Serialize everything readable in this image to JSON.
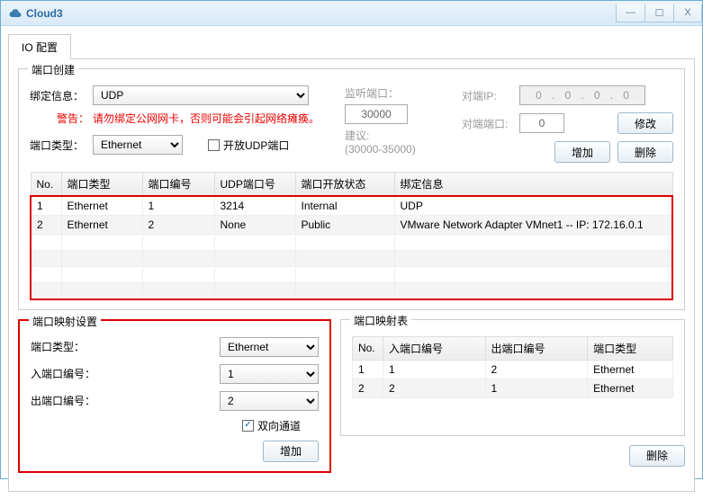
{
  "window": {
    "title": "Cloud3"
  },
  "tab": {
    "label": "IO 配置"
  },
  "portCreate": {
    "legend": "端口创建",
    "bindInfoLabel": "绑定信息：",
    "bindInfoValue": "UDP",
    "warningLabel": "警告：",
    "warningText": "请勿绑定公网网卡，否则可能会引起网络瘫痪。",
    "portTypeLabel": "端口类型：",
    "portTypeValue": "Ethernet",
    "openUdpLabel": "开放UDP端口",
    "listenPortLabel": "监听端口：",
    "listenPortValue": "30000",
    "suggestLabel": "建议:",
    "suggestRange": "(30000-35000)",
    "peerIpLabel": "对端IP:",
    "peerIp": {
      "a": "0",
      "b": "0",
      "c": "0",
      "d": "0"
    },
    "peerPortLabel": "对端端口:",
    "peerPortValue": "0",
    "modifyBtn": "修改",
    "addBtn": "增加",
    "deleteBtn": "删除",
    "table": {
      "headers": {
        "no": "No.",
        "type": "端口类型",
        "num": "端口编号",
        "udp": "UDP端口号",
        "open": "端口开放状态",
        "bind": "绑定信息"
      },
      "rows": [
        {
          "no": "1",
          "type": "Ethernet",
          "num": "1",
          "udp": "3214",
          "open": "Internal",
          "bind": "UDP"
        },
        {
          "no": "2",
          "type": "Ethernet",
          "num": "2",
          "udp": "None",
          "open": "Public",
          "bind": "VMware Network Adapter VMnet1 -- IP: 172.16.0.1"
        }
      ]
    }
  },
  "mapSettings": {
    "legend": "端口映射设置",
    "portTypeLabel": "端口类型：",
    "portTypeValue": "Ethernet",
    "inLabel": "入端口编号：",
    "inValue": "1",
    "outLabel": "出端口编号：",
    "outValue": "2",
    "bidiLabel": "双向通道",
    "addBtn": "增加"
  },
  "mapTable": {
    "legend": "端口映射表",
    "headers": {
      "no": "No.",
      "in": "入端口编号",
      "out": "出端口编号",
      "type": "端口类型"
    },
    "rows": [
      {
        "no": "1",
        "in": "1",
        "out": "2",
        "type": "Ethernet"
      },
      {
        "no": "2",
        "in": "2",
        "out": "1",
        "type": "Ethernet"
      }
    ],
    "deleteBtn": "删除"
  }
}
